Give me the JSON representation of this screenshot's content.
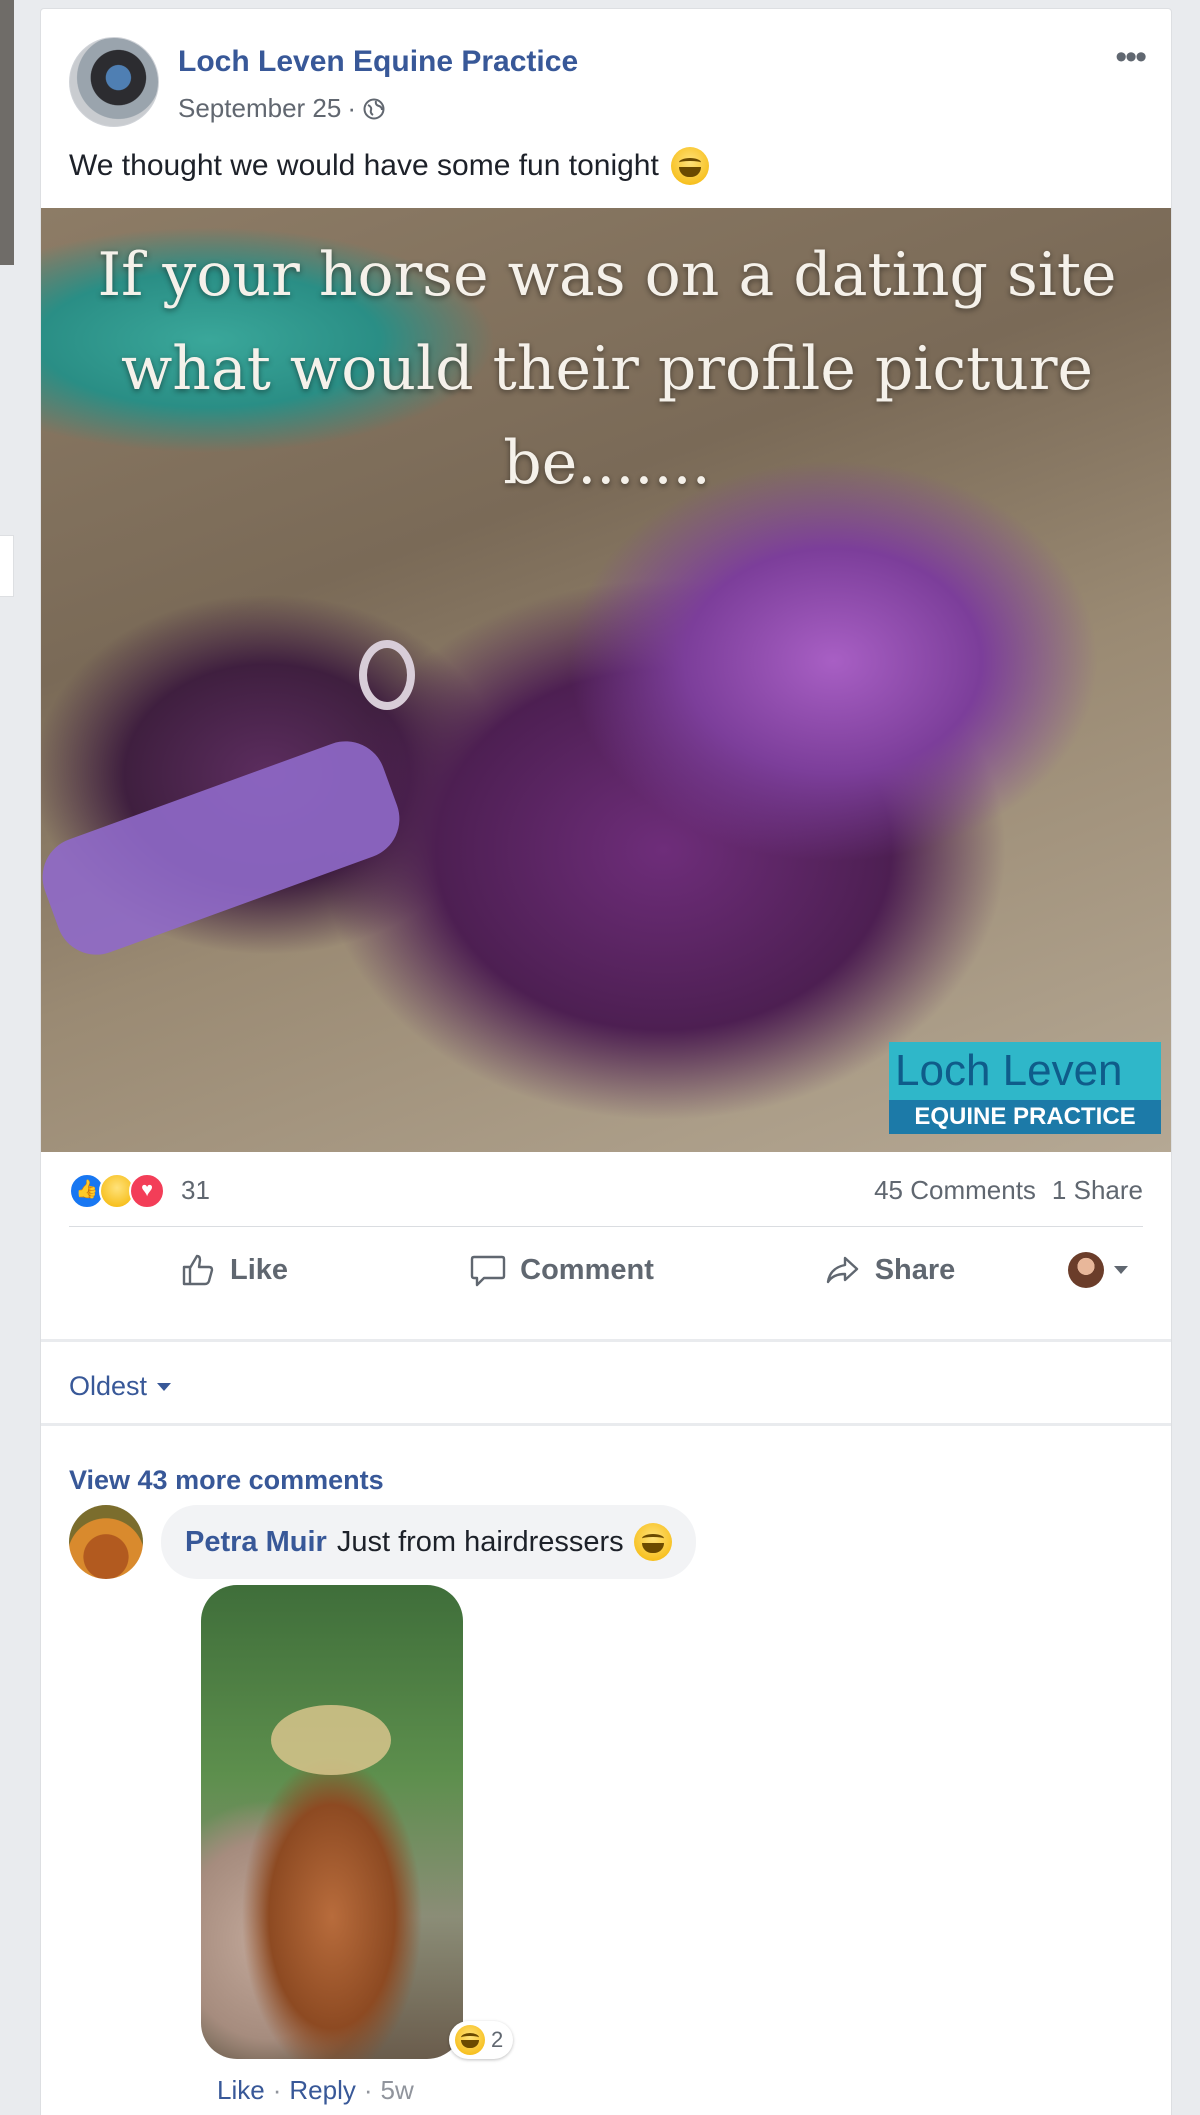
{
  "post": {
    "page_name": "Loch Leven Equine Practice",
    "date": "September 25",
    "date_sep": "·",
    "text": "We thought we would have some fun tonight",
    "more_icon": "•••",
    "image": {
      "caption_line1": "If your horse was on a dating site",
      "caption_line2": "what would their profile picture",
      "caption_line3": "be.......",
      "logo_top": "Loch Leven",
      "logo_bottom": "EQUINE PRACTICE"
    }
  },
  "reactions": {
    "icons": [
      "like-icon",
      "haha-icon",
      "love-icon"
    ],
    "count": "31",
    "comments": "45 Comments",
    "shares": "1 Share"
  },
  "actions": {
    "like": "Like",
    "comment": "Comment",
    "share": "Share"
  },
  "comments_section": {
    "sort_label": "Oldest",
    "view_more": "View 43 more comments",
    "items": [
      {
        "author": "Petra Muir",
        "text": "Just from hairdressers",
        "reaction_count": "2",
        "like": "Like",
        "reply": "Reply",
        "time": "5w",
        "sep": "·"
      }
    ]
  },
  "colors": {
    "link": "#385898",
    "background": "#e9ebee",
    "like_blue": "#1877f2",
    "love_red": "#f33e58"
  }
}
